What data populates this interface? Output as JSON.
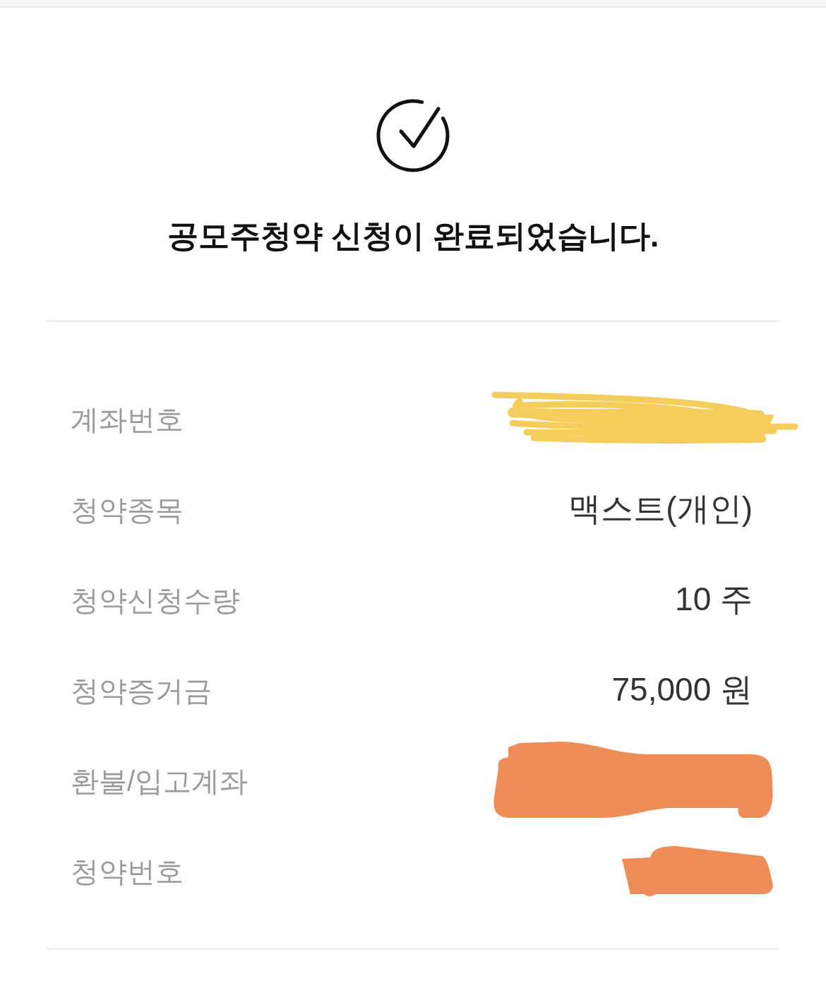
{
  "title": "공모주청약 신청이 완료되었습니다.",
  "details": [
    {
      "label": "계좌번호",
      "kind": "scribble",
      "color": "#f5cd5b"
    },
    {
      "label": "청약종목",
      "kind": "text",
      "value": "맥스트(개인)"
    },
    {
      "label": "청약신청수량",
      "kind": "text",
      "value": "10 주"
    },
    {
      "label": "청약증거금",
      "kind": "text",
      "value": "75,000 원"
    },
    {
      "label": "환불/입고계좌",
      "kind": "brush",
      "color": "#ef8d59"
    },
    {
      "label": "청약번호",
      "kind": "brush",
      "color": "#ef8d59"
    }
  ]
}
